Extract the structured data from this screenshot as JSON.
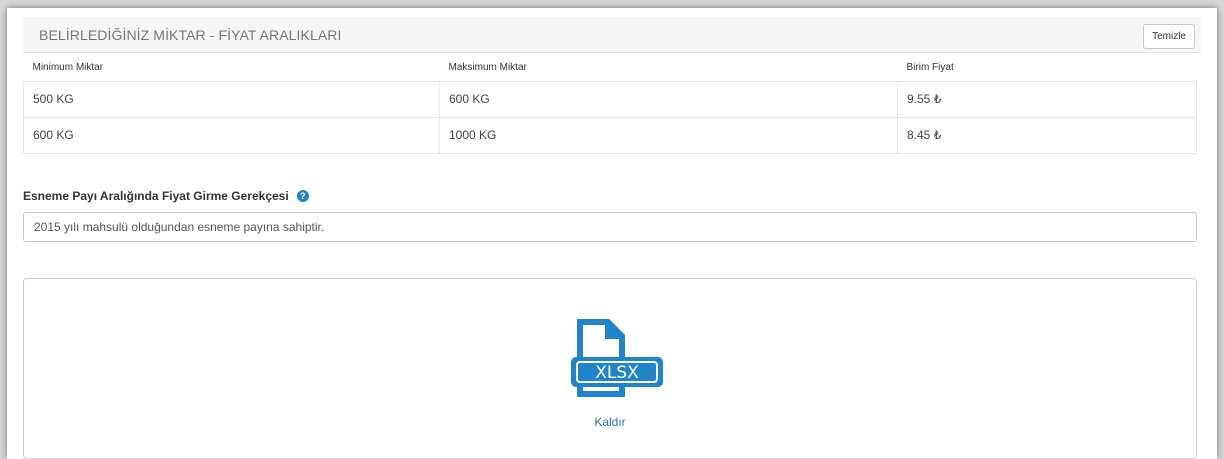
{
  "header": {
    "title": "BELİRLEDİĞİNİZ MİKTAR - FİYAT ARALIKLARI",
    "clear_label": "Temizle"
  },
  "table": {
    "columns": [
      "Minimum Miktar",
      "Maksimum Miktar",
      "Birim Fiyat"
    ],
    "rows": [
      [
        "500 KG",
        "600 KG",
        "9.55 ₺"
      ],
      [
        "600 KG",
        "1000 KG",
        "8.45 ₺"
      ]
    ]
  },
  "reason": {
    "label": "Esneme Payı Aralığında Fiyat Girme Gerekçesi",
    "value": "2015 yılı mahsulü olduğundan esneme payına sahiptir."
  },
  "upload": {
    "file_type": "XLSX",
    "icon": "xlsx-file-icon",
    "remove_label": "Kaldır"
  },
  "colors": {
    "accent": "#1f84c9",
    "link": "#2a6fb0"
  }
}
